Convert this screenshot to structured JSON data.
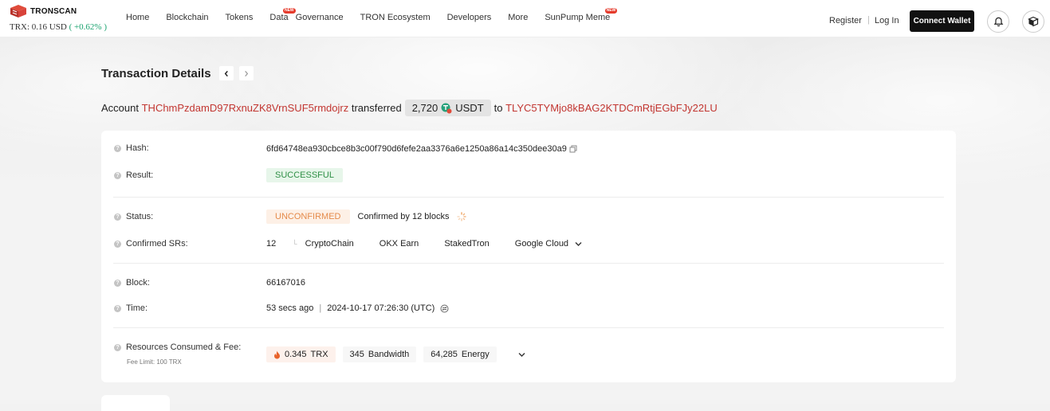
{
  "header": {
    "brand": "TRONSCAN",
    "price_label": "TRX: 0.16 USD",
    "price_change": "( +0.62% )",
    "nav": [
      {
        "label": "Home"
      },
      {
        "label": "Blockchain"
      },
      {
        "label": "Tokens"
      },
      {
        "label": "Data",
        "badge": "NEW"
      },
      {
        "label": "Governance"
      },
      {
        "label": "TRON Ecosystem"
      },
      {
        "label": "Developers"
      },
      {
        "label": "More"
      },
      {
        "label": "SunPump Meme",
        "badge": "NEW"
      }
    ],
    "register": "Register",
    "separator": "|",
    "login": "Log In",
    "connect_wallet": "Connect Wallet",
    "icons": [
      "bell-icon",
      "wallet-cube-icon"
    ]
  },
  "page": {
    "title": "Transaction Details",
    "prev_icon": "chevron-left-icon",
    "next_icon": "chevron-right-icon"
  },
  "summary": {
    "account_label": "Account",
    "from_address": "THChmPzdamD97RxnuZK8VrnSUF5rmdojrz",
    "action": "transferred",
    "amount": "2,720",
    "token": "USDT",
    "to_label": "to",
    "to_address": "TLYC5TYMjo8kBAG2KTDCmRtjEGbFJy22LU"
  },
  "details": {
    "hash_label": "Hash:",
    "hash": "6fd64748ea930cbce8b3c00f790d6fefe2aa3376a6e1250a86a14c350dee30a9",
    "result_label": "Result:",
    "result": "SUCCESSFUL",
    "status_label": "Status:",
    "status": "UNCONFIRMED",
    "confirmed_by": "Confirmed by 12 blocks",
    "srs_label": "Confirmed SRs:",
    "srs_count": "12",
    "srs": [
      "CryptoChain",
      "OKX Earn",
      "StakedTron",
      "Google Cloud"
    ],
    "block_label": "Block:",
    "block": "66167016",
    "time_label": "Time:",
    "time_ago": "53 secs ago",
    "time_sep": "|",
    "time_utc": "2024-10-17 07:26:30 (UTC)",
    "resources_label": "Resources Consumed & Fee:",
    "fee_limit": "Fee Limit: 100 TRX",
    "trx_amount": "0.345",
    "trx_unit": "TRX",
    "bandwidth_amount": "345",
    "bandwidth_unit": "Bandwidth",
    "energy_amount": "64,285",
    "energy_unit": "Energy",
    "help_glyph": "?"
  },
  "colors": {
    "address_red": "#c23631",
    "success_green": "#2f8f46",
    "unconfirmed_orange": "#e58a4a",
    "change_green": "#1aa36f"
  }
}
